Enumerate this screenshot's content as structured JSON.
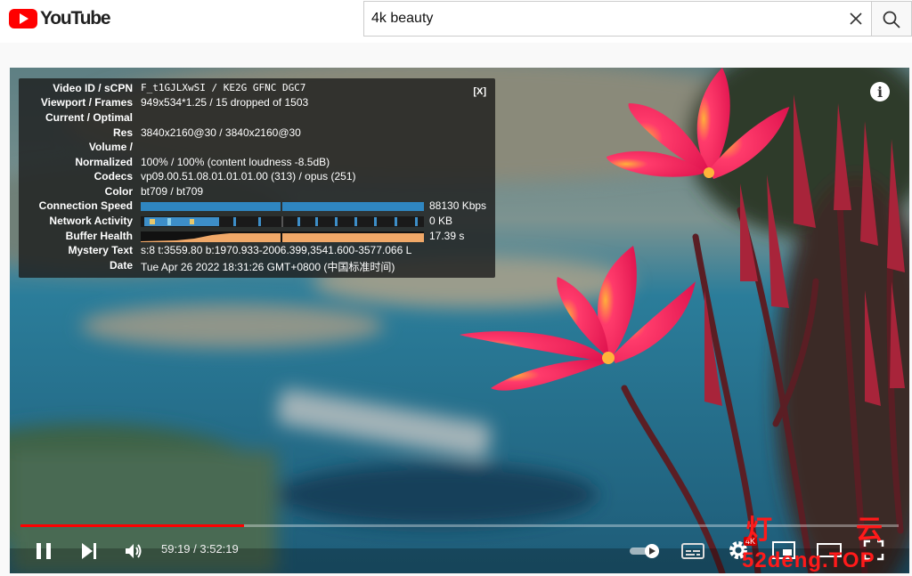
{
  "header": {
    "logo_text": "YouTube",
    "search_value": "4k beauty"
  },
  "stats": {
    "close_label": "[X]",
    "rows": [
      {
        "label": "Video ID / sCPN",
        "value": "F_t1GJLXwSI / KE2G GFNC DGC7"
      },
      {
        "label": "Viewport / Frames",
        "value": "949x534*1.25 / 15 dropped of 1503"
      },
      {
        "label": "Current / Optimal",
        "value": ""
      },
      {
        "label": "Res",
        "value": "3840x2160@30 / 3840x2160@30"
      },
      {
        "label": "Volume /",
        "value": ""
      },
      {
        "label": "Normalized",
        "value": "100% / 100% (content loudness -8.5dB)"
      },
      {
        "label": "Codecs",
        "value": "vp09.00.51.08.01.01.01.00 (313) / opus (251)"
      },
      {
        "label": "Color",
        "value": "bt709 / bt709"
      },
      {
        "label": "Connection Speed",
        "value": "88130 Kbps"
      },
      {
        "label": "Network Activity",
        "value": "0 KB"
      },
      {
        "label": "Buffer Health",
        "value": "17.39 s"
      },
      {
        "label": "Mystery Text",
        "value": "s:8 t:3559.80 b:1970.933-2006.399,3541.600-3577.066 L"
      },
      {
        "label": "Date",
        "value": "Tue Apr 26 2022 18:31:26 GMT+0800 (中国标准时间)"
      }
    ]
  },
  "player": {
    "current_time": "59:19",
    "duration": "3:52:19",
    "time_display": "59:19 / 3:52:19",
    "progress_fraction": 0.255,
    "quality_badge": "4K",
    "colors": {
      "progress": "#ff0000",
      "stats_bg": "rgba(28,28,28,0.80)",
      "speed_bar": "#2f86c1",
      "buffer_bar": "#f0a868"
    }
  },
  "watermark": {
    "glyph1": "灯",
    "glyph2": "云",
    "site": "52deng.TOP"
  },
  "icons": [
    "search-icon",
    "close-icon",
    "info-icon",
    "pause-icon",
    "next-icon",
    "volume-icon",
    "autoplay-toggle-icon",
    "subtitles-icon",
    "settings-icon",
    "miniplayer-icon",
    "theater-icon",
    "fullscreen-icon"
  ]
}
